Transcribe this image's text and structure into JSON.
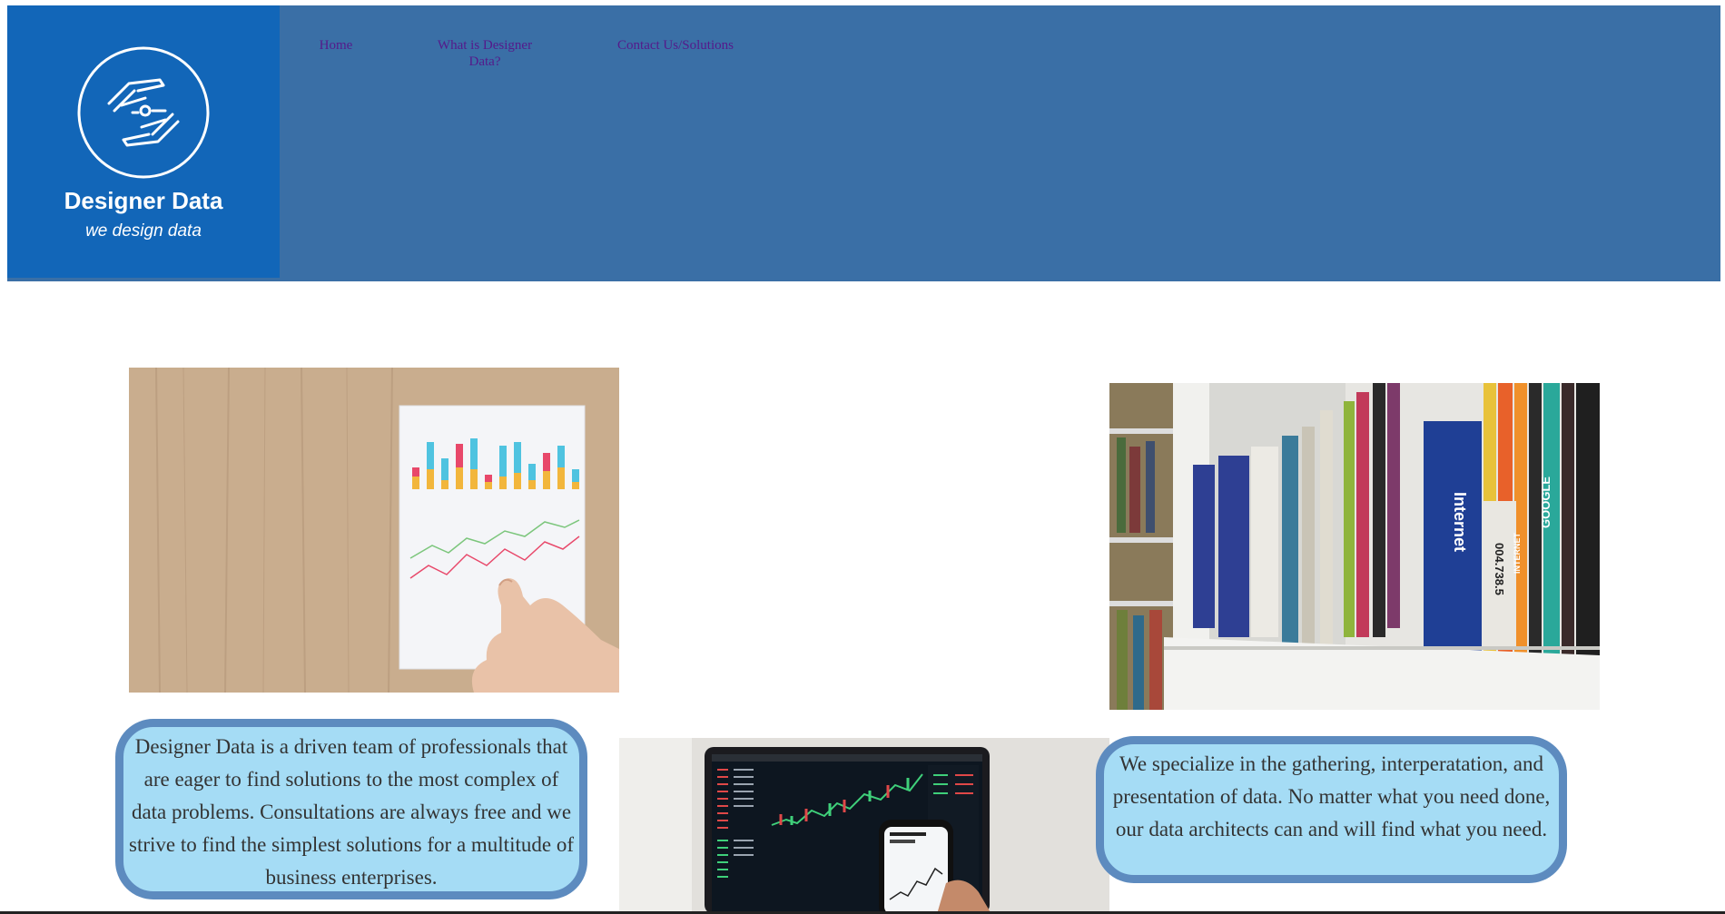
{
  "brand": {
    "name": "Designer Data",
    "tagline": "we design data"
  },
  "nav": {
    "home": "Home",
    "what_is": "What is Designer Data?",
    "contact": "Contact Us/Solutions"
  },
  "photos": {
    "chart_sheet": "chart-on-wooden-table",
    "bookshelf": "bookshelf-internet-books",
    "trading": "laptop-and-phone-trading-charts"
  },
  "book_spines": [
    "Internet",
    "004.738.5",
    "GOOGLE",
    "INTERNET"
  ],
  "about_text": "Designer Data is a driven team of professionals that are eager to find solutions to the most complex of data problems. Consultations are always free and we strive to find the simplest solutions for a multitude of business enterprises.",
  "specialize_text": "We specialize in the gathering, interperatation, and presentation of data. No matter what you need done, our data architects can and will find what you need.",
  "colors": {
    "header_bg": "#3a6fa6",
    "logo_bg": "#1266b8",
    "nav_link": "#551a8b",
    "bubble_bg": "#a5dcf5",
    "bubble_border": "#5d8bbf"
  }
}
